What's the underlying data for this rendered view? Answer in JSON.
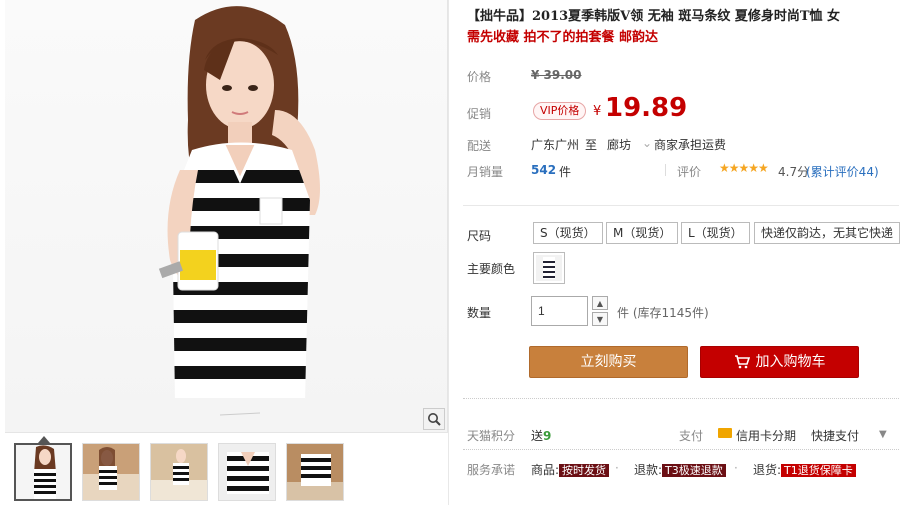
{
  "product": {
    "title": "【拙牛品】2013夏季韩版V领 无袖 斑马条纹 夏修身时尚T恤 女",
    "subtitle": "需先收藏 拍不了的拍套餐 邮韵达"
  },
  "price": {
    "label": "价格",
    "original": "¥ 39.00",
    "promo_label": "促销",
    "vip_badge": "VIP价格",
    "currency": "¥",
    "promo_value": "19.89"
  },
  "shipping": {
    "label": "配送",
    "from": "广东广州",
    "to_word": "至",
    "to": "廊坊",
    "fee": "商家承担运费"
  },
  "sales": {
    "label": "月销量",
    "count": "542",
    "unit": "件",
    "review_label": "评价",
    "stars": "★★★★★",
    "rating": "4.7分",
    "review_count": "(累计评价44)"
  },
  "options": {
    "size_label": "尺码",
    "sizes": [
      "S（现货）",
      "M（现货）",
      "L（现货）",
      "快递仅韵达，无其它快递"
    ],
    "color_label": "主要颜色"
  },
  "quantity": {
    "label": "数量",
    "value": "1",
    "unit_stock": "件 (库存1145件)"
  },
  "actions": {
    "buy": "立刻购买",
    "cart": "加入购物车"
  },
  "extras": {
    "points_label": "天猫积分",
    "points_prefix": "送",
    "points_value": "9",
    "pay_label": "支付",
    "card_pay": "信用卡分期",
    "quick_pay": "快捷支付"
  },
  "service": {
    "label": "服务承诺",
    "items": [
      {
        "prefix": "商品:",
        "tag": "按时发货"
      },
      {
        "prefix": "退款:",
        "tag": "T3极速退款"
      },
      {
        "prefix": "退货:",
        "tag": "T1退货保障卡"
      }
    ]
  },
  "colors": {
    "accent_red": "#c40000",
    "buy_button": "#c8803c",
    "link_blue": "#2a6fbe"
  }
}
